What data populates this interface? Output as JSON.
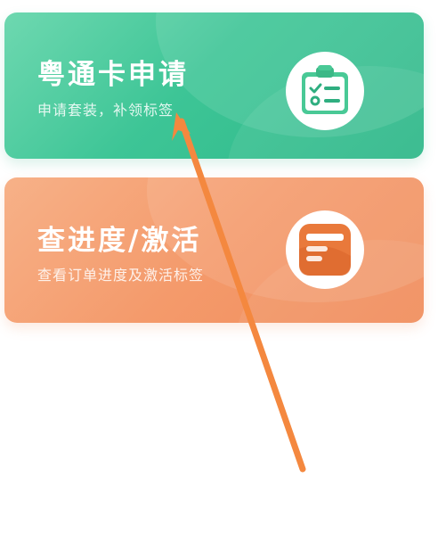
{
  "cards": [
    {
      "title": "粤通卡申请",
      "subtitle": "申请套装，补领标签",
      "icon": "clipboard-checklist-icon",
      "color": "#3dc596"
    },
    {
      "title": "查进度/激活",
      "subtitle": "查看订单进度及激活标签",
      "icon": "document-card-icon",
      "color": "#f49a6b"
    }
  ],
  "annotation": {
    "icon": "arrow-annotation",
    "color": "#f4883f"
  }
}
